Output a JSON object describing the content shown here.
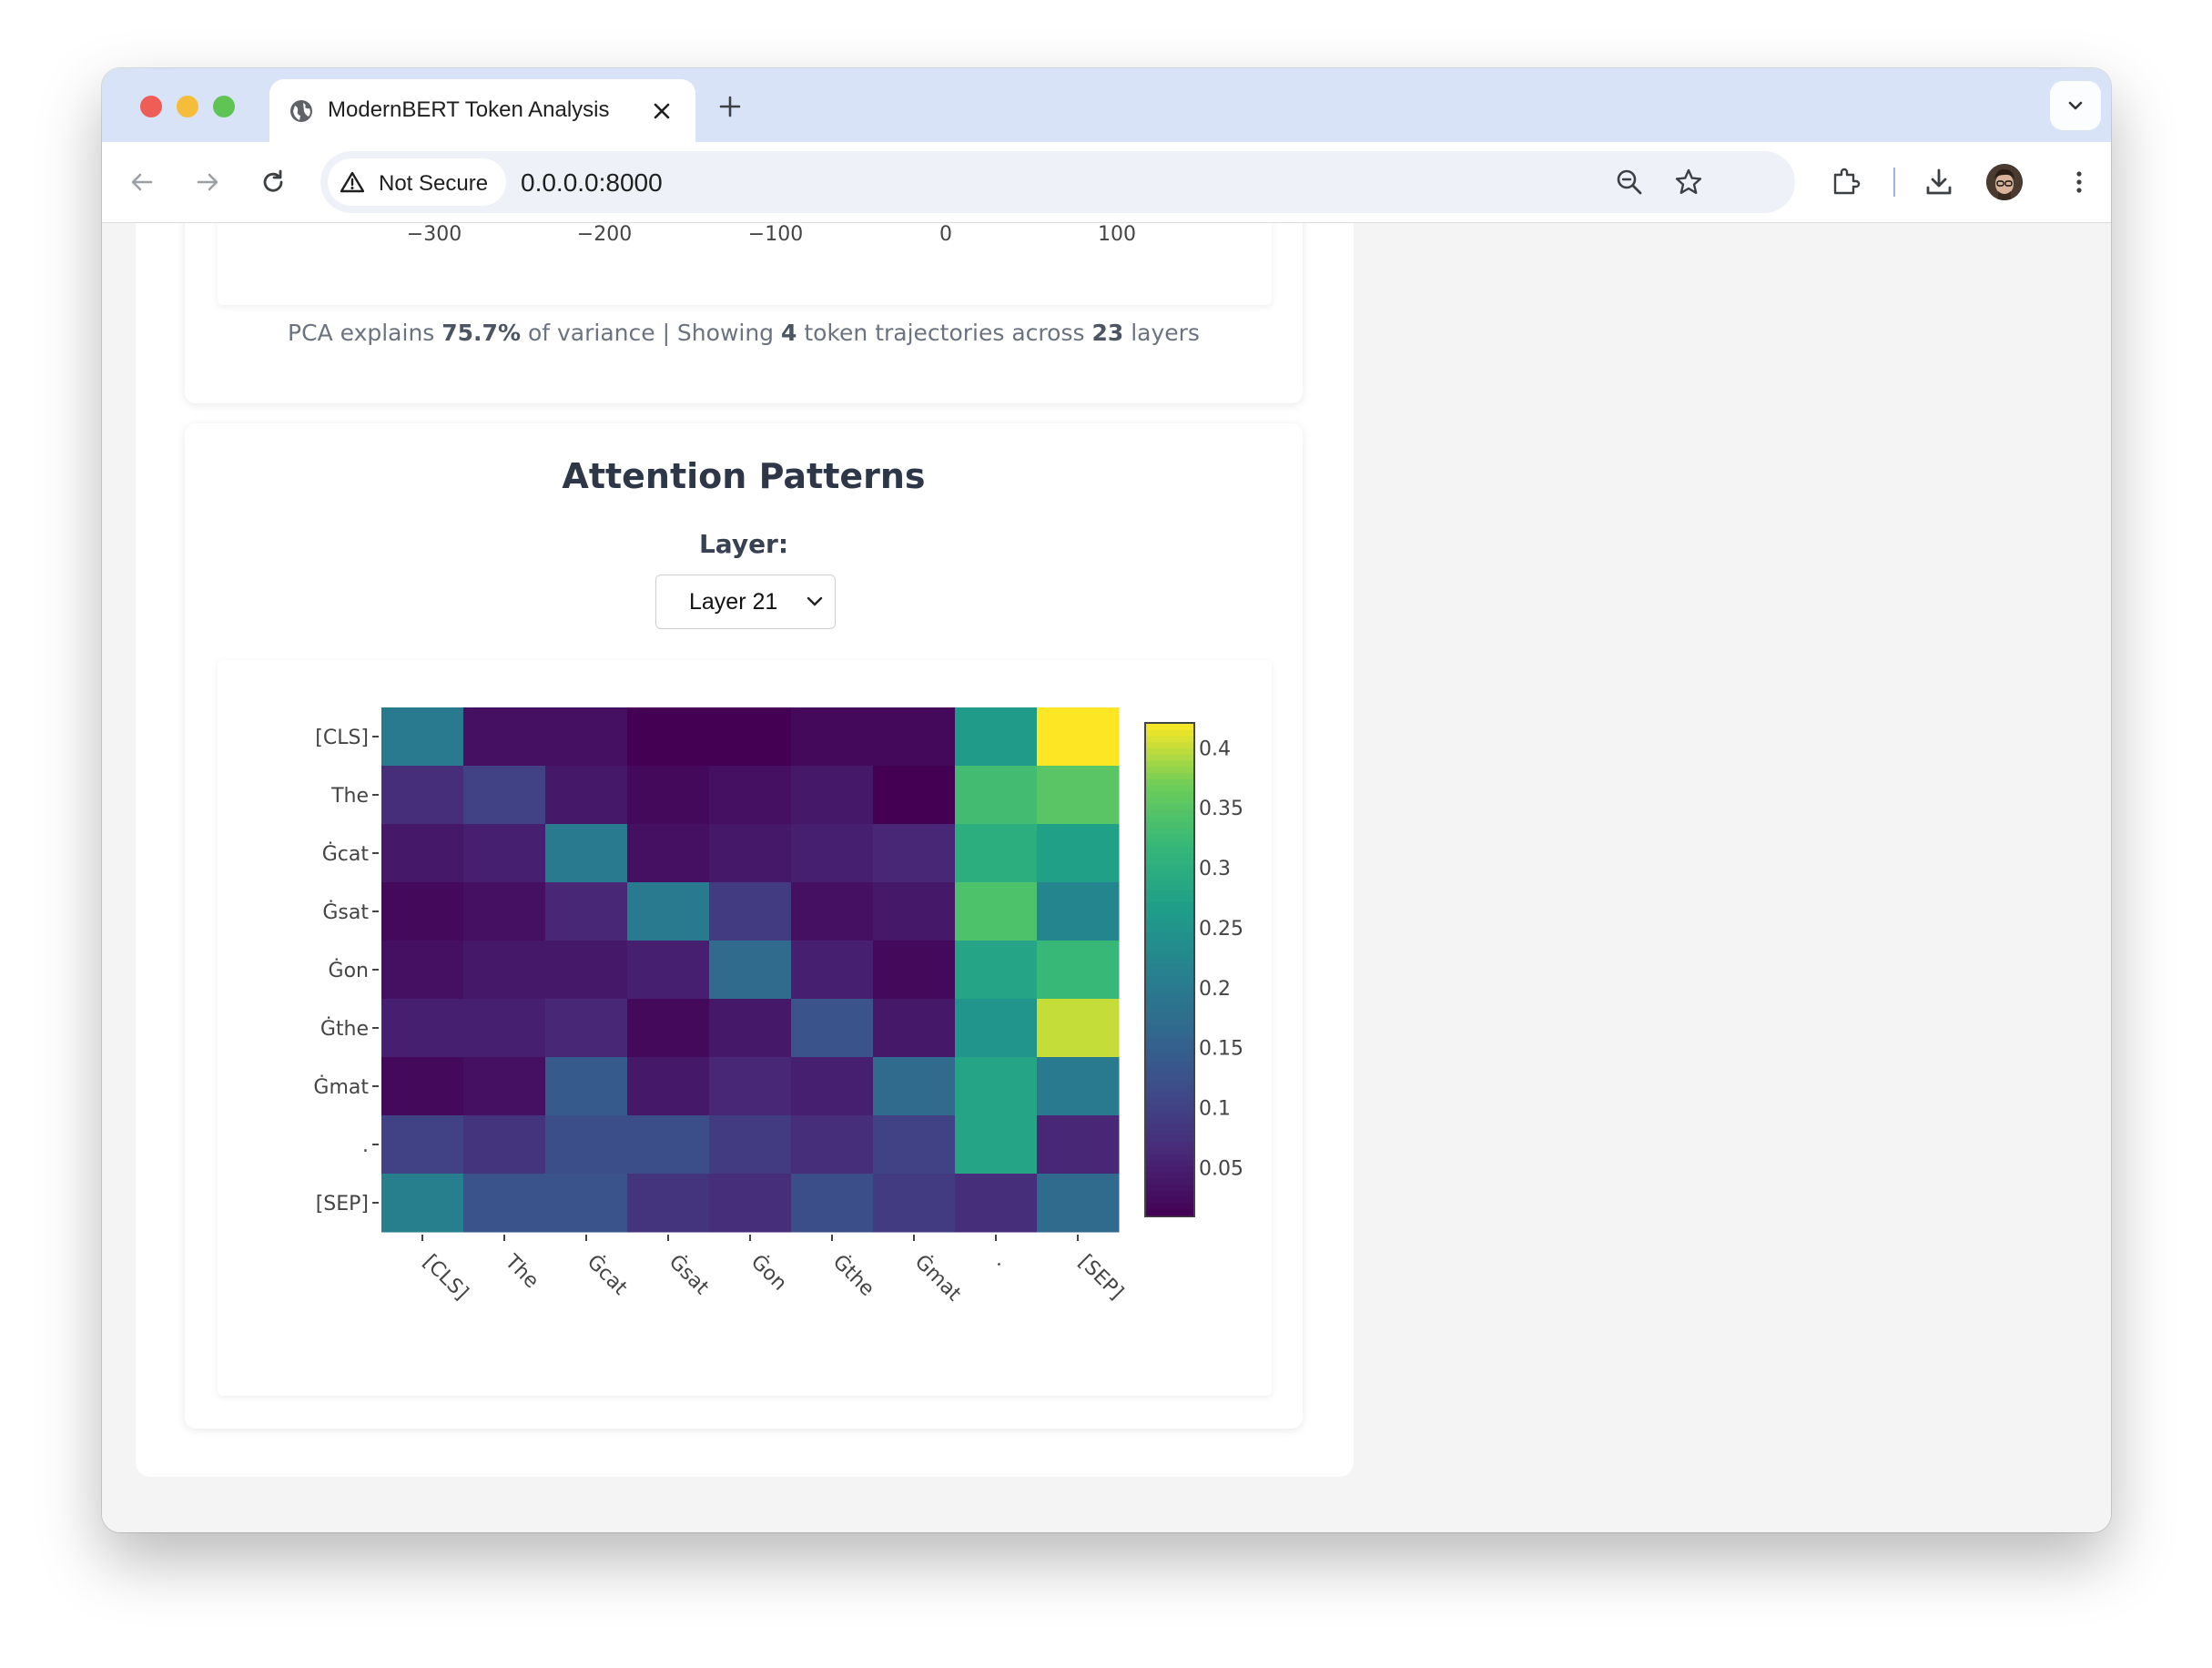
{
  "browser": {
    "tab_title": "ModernBERT Token Analysis",
    "security_label": "Not Secure",
    "url": "0.0.0.0:8000"
  },
  "pca": {
    "x_ticks": [
      "−300",
      "−200",
      "−100",
      "0",
      "100"
    ],
    "stats": {
      "prefix": "PCA explains ",
      "variance": "75.7%",
      "mid1": " of variance | Showing ",
      "token_count": "4",
      "mid2": " token trajectories across ",
      "layer_count": "23",
      "suffix": " layers"
    }
  },
  "attention": {
    "title": "Attention Patterns",
    "layer_label": "Layer:",
    "selected_layer": "Layer 21"
  },
  "chart_data": {
    "type": "heatmap",
    "title": "",
    "xlabel": "",
    "ylabel": "",
    "x": [
      "[CLS]",
      "The",
      "Ġcat",
      "Ġsat",
      "Ġon",
      "Ġthe",
      "Ġmat",
      ".",
      "[SEP]"
    ],
    "y": [
      "[CLS]",
      "The",
      "Ġcat",
      "Ġsat",
      "Ġon",
      "Ġthe",
      "Ġmat",
      ".",
      "[SEP]"
    ],
    "z": [
      [
        0.2,
        0.03,
        0.03,
        0.01,
        0.01,
        0.02,
        0.02,
        0.26,
        0.42
      ],
      [
        0.07,
        0.1,
        0.04,
        0.02,
        0.03,
        0.04,
        0.01,
        0.33,
        0.35
      ],
      [
        0.04,
        0.05,
        0.2,
        0.03,
        0.04,
        0.05,
        0.06,
        0.3,
        0.27
      ],
      [
        0.02,
        0.03,
        0.06,
        0.2,
        0.09,
        0.03,
        0.04,
        0.34,
        0.22
      ],
      [
        0.03,
        0.04,
        0.04,
        0.05,
        0.17,
        0.05,
        0.02,
        0.28,
        0.32
      ],
      [
        0.05,
        0.05,
        0.06,
        0.02,
        0.04,
        0.13,
        0.04,
        0.25,
        0.4
      ],
      [
        0.02,
        0.03,
        0.14,
        0.04,
        0.06,
        0.05,
        0.17,
        0.28,
        0.2
      ],
      [
        0.1,
        0.08,
        0.12,
        0.12,
        0.09,
        0.07,
        0.1,
        0.28,
        0.06
      ],
      [
        0.21,
        0.13,
        0.13,
        0.08,
        0.07,
        0.12,
        0.09,
        0.07,
        0.17
      ]
    ],
    "colorscale": "Viridis",
    "zmin": 0.01,
    "zmax": 0.42,
    "colorbar_ticks": [
      "0.4",
      "0.35",
      "0.3",
      "0.25",
      "0.2",
      "0.15",
      "0.1",
      "0.05"
    ],
    "colorbar_tick_values": [
      0.4,
      0.35,
      0.3,
      0.25,
      0.2,
      0.15,
      0.1,
      0.05
    ]
  }
}
